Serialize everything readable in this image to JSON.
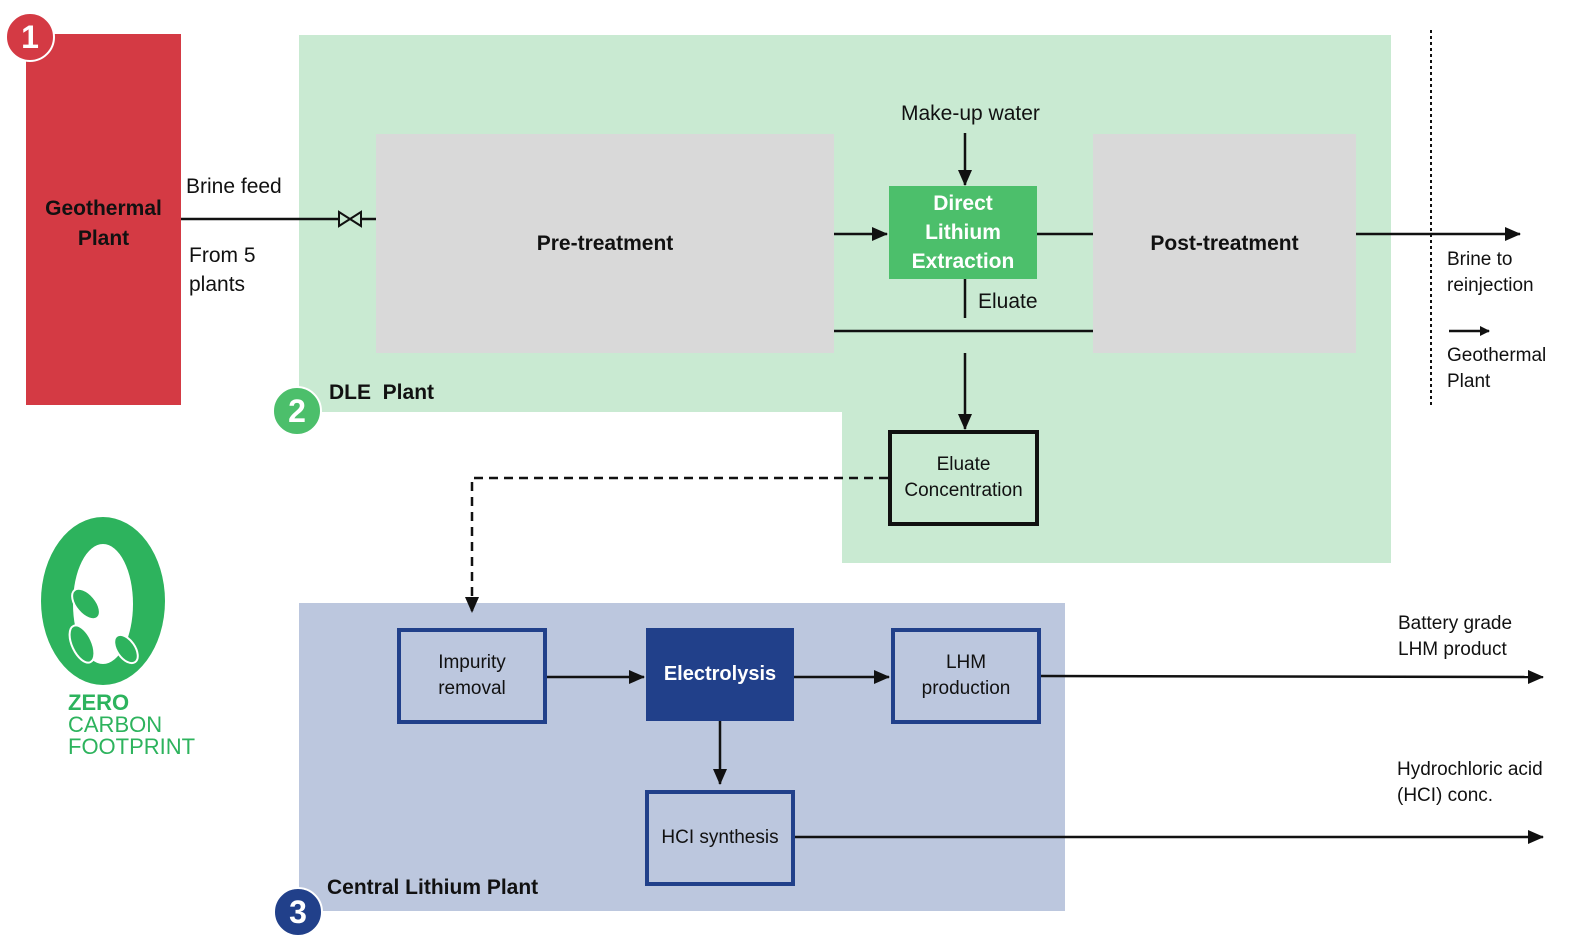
{
  "colors": {
    "geothermal": "#d43a44",
    "dle_bg": "#c9ead2",
    "dle_accent": "#4cbf6b",
    "process_gray": "#d9d9d9",
    "central_bg": "#bcc7de",
    "central_accent": "#21408a",
    "line": "#111111"
  },
  "geothermal": {
    "badge": "1",
    "label_line1": "Geothermal",
    "label_line2": "Plant"
  },
  "feed": {
    "label": "Brine feed",
    "source_line1": "From 5",
    "source_line2": "plants"
  },
  "dle": {
    "badge": "2",
    "title": "DLE  Plant",
    "pretreatment": "Pre-treatment",
    "dle_line1": "Direct",
    "dle_line2": "Lithium",
    "dle_line3": "Extraction",
    "posttreatment": "Post-treatment",
    "makeup_water": "Make-up water",
    "eluate": "Eluate",
    "eluate_conc_line1": "Eluate",
    "eluate_conc_line2": "Concentration"
  },
  "outlet": {
    "brine_line1": "Brine to",
    "brine_line2": "reinjection",
    "geo_line1": "Geothermal",
    "geo_line2": "Plant"
  },
  "central": {
    "badge": "3",
    "title": "Central Lithium Plant",
    "impurity_line1": "Impurity",
    "impurity_line2": "removal",
    "electrolysis": "Electrolysis",
    "lhm_line1": "LHM",
    "lhm_line2": "production",
    "hcl": "HCI synthesis"
  },
  "products": {
    "lhm_line1": "Battery grade",
    "lhm_line2": "LHM product",
    "hcl_line1": "Hydrochloric acid",
    "hcl_line2": "(HCI) conc."
  },
  "logo": {
    "line1": "ZERO",
    "line2": "CARBON",
    "line3": "FOOTPRINT"
  }
}
